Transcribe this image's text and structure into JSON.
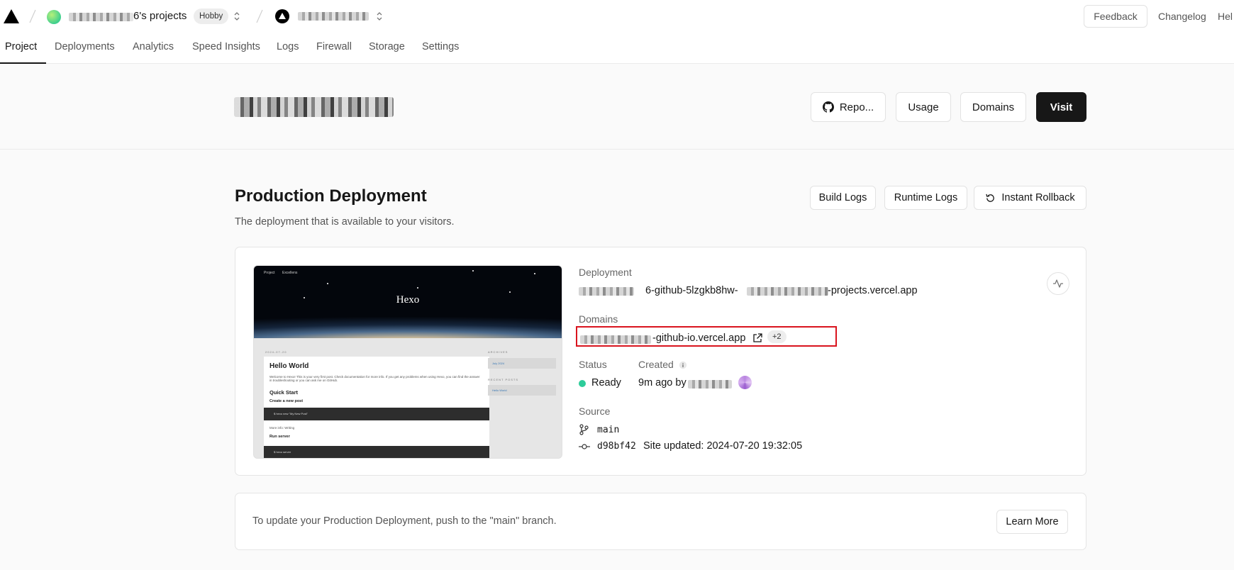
{
  "topbar": {
    "team_name": "6's projects",
    "plan_badge": "Hobby",
    "feedback_label": "Feedback",
    "changelog_label": "Changelog",
    "help_label": "Hel"
  },
  "tabs": [
    {
      "label": "Project",
      "active": true
    },
    {
      "label": "Deployments"
    },
    {
      "label": "Analytics"
    },
    {
      "label": "Speed Insights"
    },
    {
      "label": "Logs"
    },
    {
      "label": "Firewall"
    },
    {
      "label": "Storage"
    },
    {
      "label": "Settings"
    }
  ],
  "project_header": {
    "repo_label": "Repo...",
    "usage_label": "Usage",
    "domains_label": "Domains",
    "visit_label": "Visit"
  },
  "production": {
    "title": "Production Deployment",
    "subtitle": "The deployment that is available to your visitors.",
    "build_logs_label": "Build Logs",
    "runtime_logs_label": "Runtime Logs",
    "rollback_label": "Instant Rollback"
  },
  "preview": {
    "nav": [
      "Project",
      "Excellens"
    ],
    "hero_title": "Hexo",
    "date": "2024-07-20",
    "post_title": "Hello World",
    "intro": "Welcome to Hexo! This is your very first post. Check documentation for more info. If you get any problems when using Hexo, you can find the answer in troubleshooting or you can ask me on GitHub.",
    "quick_start": "Quick Start",
    "create_post": "Create a new post",
    "code1": "$ hexo new \"My New Post\"",
    "more_info": "More info: Writing",
    "run_server": "Run server",
    "code2": "$ hexo server",
    "archives_heading": "ARCHIVES",
    "archives_item": "July 2024",
    "recent_heading": "RECENT POSTS",
    "recent_item": "Hello World"
  },
  "details": {
    "deployment_label": "Deployment",
    "deployment_url_mid": "6-github-5lzgkb8hw-",
    "deployment_url_end": "-projects.vercel.app",
    "domains_label": "Domains",
    "domain_url_end": "-github-io.vercel.app",
    "domains_extra": "+2",
    "status_label": "Status",
    "status_value": "Ready",
    "created_label": "Created",
    "created_value": "9m ago by",
    "source_label": "Source",
    "branch": "main",
    "commit_hash": "d98bf42",
    "commit_message": "Site updated: 2024-07-20 19:32:05"
  },
  "info_card": {
    "text": "To update your Production Deployment, push to the \"main\" branch.",
    "learn_more_label": "Learn More"
  },
  "colors": {
    "accent": "#171717",
    "status_ready": "#2ecc9a",
    "highlight": "#d9141e"
  }
}
